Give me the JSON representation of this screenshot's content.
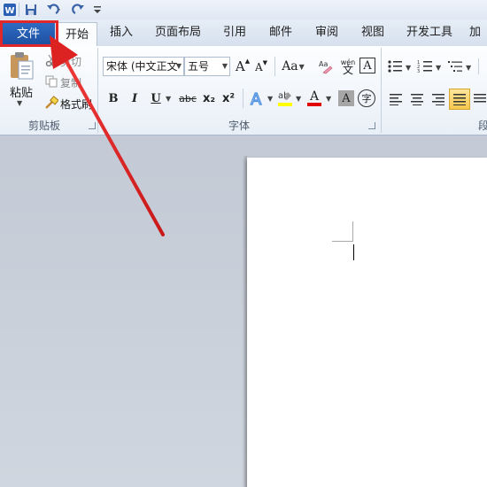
{
  "quick_access": {
    "app_icon": "word-icon",
    "items": [
      "save-icon",
      "undo-icon",
      "redo-icon",
      "customize-icon"
    ]
  },
  "tabs": [
    {
      "label": "文件",
      "active": false,
      "highlighted": true
    },
    {
      "label": "开始",
      "active": true
    },
    {
      "label": "插入"
    },
    {
      "label": "页面布局"
    },
    {
      "label": "引用"
    },
    {
      "label": "邮件"
    },
    {
      "label": "审阅"
    },
    {
      "label": "视图"
    },
    {
      "label": "开发工具"
    },
    {
      "label": "加"
    }
  ],
  "clipboard": {
    "paste_label": "粘贴",
    "cut_label": "剪切",
    "copy_label": "复制",
    "format_painter_label": "格式刷",
    "group_label": "剪贴板"
  },
  "font": {
    "font_name": "宋体 (中文正文",
    "font_size": "五号",
    "group_label": "字体",
    "bold": "B",
    "italic": "I",
    "underline": "U",
    "strikethrough": "abc",
    "subscript": "x₂",
    "superscript": "x²",
    "font_color_letter": "A",
    "grow_font": "A",
    "shrink_font": "A",
    "change_case": "Aa",
    "phonetic": "wén",
    "char_border": "A",
    "char_shading": "A",
    "enclose": "字"
  },
  "paragraph": {
    "group_label": "段"
  },
  "colors": {
    "file_tab": "#1d4f9f",
    "highlight_red": "#e0282a",
    "text_highlight": "#ffff00",
    "font_color": "#e00000"
  }
}
